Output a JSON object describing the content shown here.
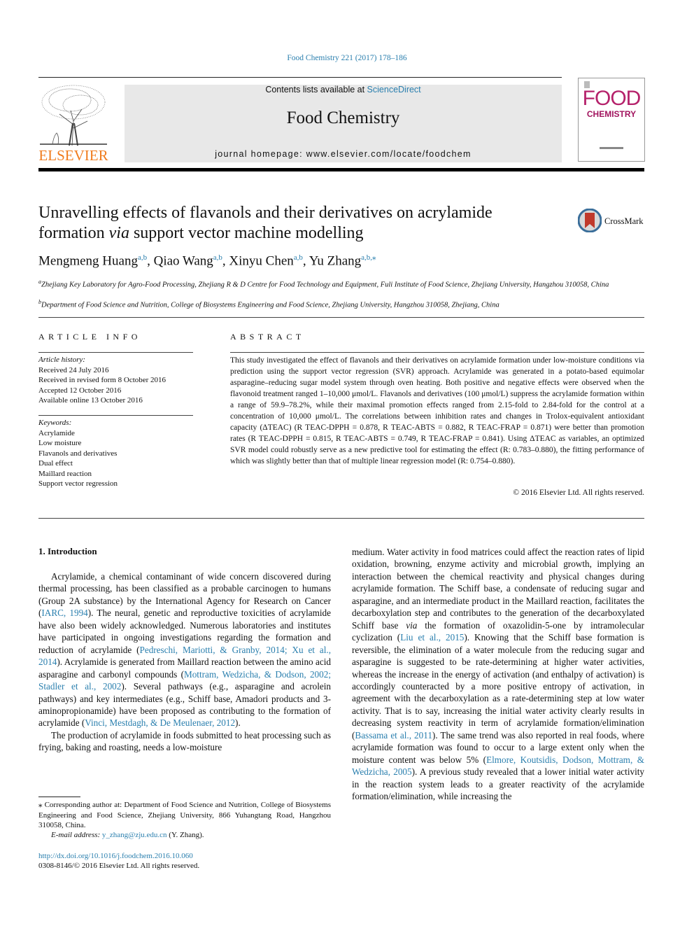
{
  "header": {
    "journal_ref": "Food Chemistry 221 (2017) 178–186",
    "contents_prefix": "Contents lists available at ",
    "contents_link": "ScienceDirect",
    "journal_name": "Food Chemistry",
    "homepage": "journal homepage: www.elsevier.com/locate/foodchem",
    "publisher_logo_text": "ELSEVIER",
    "cover_title_1": "FOOD",
    "cover_title_2": "CHEMISTRY",
    "colors": {
      "link": "#2a7fae",
      "elsevier_orange": "#f07c1e",
      "cover_magenta": "#a2155f",
      "masthead_bg": "#e8e8e8"
    }
  },
  "article": {
    "title_part1": "Unravelling effects of flavanols and their derivatives on acrylamide formation ",
    "title_italic": "via",
    "title_part2": " support vector machine modelling",
    "crossmark_label": "CrossMark",
    "authors": [
      {
        "name": "Mengmeng Huang",
        "sup": "a,b"
      },
      {
        "name": "Qiao Wang",
        "sup": "a,b"
      },
      {
        "name": "Xinyu Chen",
        "sup": "a,b"
      },
      {
        "name": "Yu Zhang",
        "sup": "a,b,⁎"
      }
    ],
    "affiliations": [
      {
        "mark": "a",
        "text": "Zhejiang Key Laboratory for Agro-Food Processing, Zhejiang R & D Centre for Food Technology and Equipment, Fuli Institute of Food Science, Zhejiang University, Hangzhou 310058, China"
      },
      {
        "mark": "b",
        "text": "Department of Food Science and Nutrition, College of Biosystems Engineering and Food Science, Zhejiang University, Hangzhou 310058, Zhejiang, China"
      }
    ]
  },
  "article_info": {
    "heading": "ARTICLE INFO",
    "history_label": "Article history:",
    "history": [
      "Received 24 July 2016",
      "Received in revised form 8 October 2016",
      "Accepted 12 October 2016",
      "Available online 13 October 2016"
    ],
    "keywords_label": "Keywords:",
    "keywords": [
      "Acrylamide",
      "Low moisture",
      "Flavanols and derivatives",
      "Dual effect",
      "Maillard reaction",
      "Support vector regression"
    ]
  },
  "abstract": {
    "heading": "ABSTRACT",
    "text": "This study investigated the effect of flavanols and their derivatives on acrylamide formation under low-moisture conditions via prediction using the support vector regression (SVR) approach. Acrylamide was generated in a potato-based equimolar asparagine–reducing sugar model system through oven heating. Both positive and negative effects were observed when the flavonoid treatment ranged 1–10,000 μmol/L. Flavanols and derivatives (100 μmol/L) suppress the acrylamide formation within a range of 59.9–78.2%, while their maximal promotion effects ranged from 2.15-fold to 2.84-fold for the control at a concentration of 10,000 μmol/L. The correlations between inhibition rates and changes in Trolox-equivalent antioxidant capacity (ΔTEAC) (R TEAC-DPPH = 0.878, R TEAC-ABTS = 0.882, R TEAC-FRAP = 0.871) were better than promotion rates (R TEAC-DPPH = 0.815, R TEAC-ABTS = 0.749, R TEAC-FRAP = 0.841). Using ΔTEAC as variables, an optimized SVR model could robustly serve as a new predictive tool for estimating the effect (R: 0.783–0.880), the fitting performance of which was slightly better than that of multiple linear regression model (R: 0.754–0.880).",
    "copyright": "© 2016 Elsevier Ltd. All rights reserved."
  },
  "body": {
    "intro_heading": "1. Introduction",
    "left_paragraphs": [
      [
        {
          "t": "Acrylamide, a chemical contaminant of wide concern discovered during thermal processing, has been classified as a probable carcinogen to humans (Group 2A substance) by the International Agency for Research on Cancer ("
        },
        {
          "t": "IARC, 1994",
          "link": true
        },
        {
          "t": "). The neural, genetic and reproductive toxicities of acrylamide have also been widely acknowledged. Numerous laboratories and institutes have participated in ongoing investigations regarding the formation and reduction of acrylamide ("
        },
        {
          "t": "Pedreschi, Mariotti, & Granby, 2014; Xu et al., 2014",
          "link": true
        },
        {
          "t": "). Acrylamide is generated from Maillard reaction between the amino acid asparagine and carbonyl compounds ("
        },
        {
          "t": "Mottram, Wedzicha, & Dodson, 2002; Stadler et al., 2002",
          "link": true
        },
        {
          "t": "). Several pathways (e.g., asparagine and acrolein pathways) and key intermediates (e.g., Schiff base, Amadori products and 3-aminopropionamide) have been proposed as contributing to the formation of acrylamide ("
        },
        {
          "t": "Vinci, Mestdagh, & De Meulenaer, 2012",
          "link": true
        },
        {
          "t": ")."
        }
      ],
      [
        {
          "t": "The production of acrylamide in foods submitted to heat processing such as frying, baking and roasting, needs a low-moisture"
        }
      ]
    ],
    "right_paragraph": [
      {
        "t": "medium. Water activity in food matrices could affect the reaction rates of lipid oxidation, browning, enzyme activity and microbial growth, implying an interaction between the chemical reactivity and physical changes during acrylamide formation. The Schiff base, a condensate of reducing sugar and asparagine, and an intermediate product in the Maillard reaction, facilitates the decarboxylation step and contributes to the generation of the decarboxylated Schiff base "
      },
      {
        "t": "via",
        "italic": true
      },
      {
        "t": " the formation of oxazolidin-5-one by intramolecular cyclization ("
      },
      {
        "t": "Liu et al., 2015",
        "link": true
      },
      {
        "t": "). Knowing that the Schiff base formation is reversible, the elimination of a water molecule from the reducing sugar and asparagine is suggested to be rate-determining at higher water activities, whereas the increase in the energy of activation (and enthalpy of activation) is accordingly counteracted by a more positive entropy of activation, in agreement with the decarboxylation as a rate-determining step at low water activity. That is to say, increasing the initial water activity clearly results in decreasing system reactivity in term of acrylamide formation/elimination ("
      },
      {
        "t": "Bassama et al., 2011",
        "link": true
      },
      {
        "t": "). The same trend was also reported in real foods, where acrylamide formation was found to occur to a large extent only when the moisture content was below 5% ("
      },
      {
        "t": "Elmore, Koutsidis, Dodson, Mottram, & Wedzicha, 2005",
        "link": true
      },
      {
        "t": "). A previous study revealed that a lower initial water activity in the reaction system leads to a greater reactivity of the acrylamide formation/elimination, while increasing the"
      }
    ]
  },
  "footer": {
    "corresponding": "⁎ Corresponding author at: Department of Food Science and Nutrition, College of Biosystems Engineering and Food Science, Zhejiang University, 866 Yuhangtang Road, Hangzhou 310058, China.",
    "email_label": "E-mail address: ",
    "email": "y_zhang@zju.edu.cn",
    "email_suffix": " (Y. Zhang).",
    "doi": "http://dx.doi.org/10.1016/j.foodchem.2016.10.060",
    "issn": "0308-8146/© 2016 Elsevier Ltd. All rights reserved."
  }
}
